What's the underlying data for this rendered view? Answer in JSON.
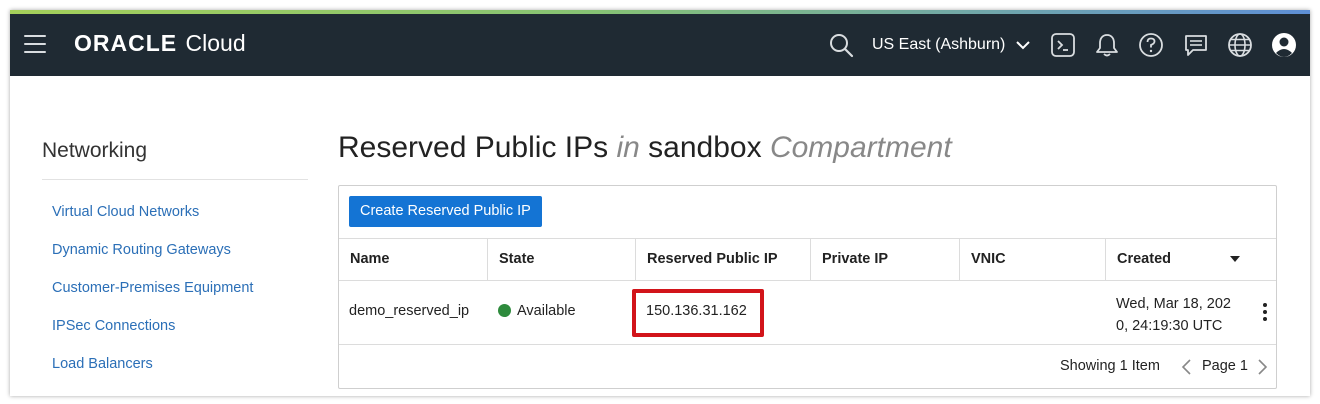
{
  "topbar": {
    "brand_oracle": "ORACLE",
    "brand_cloud": "Cloud",
    "region": "US East (Ashburn)",
    "icons": [
      "menu-icon",
      "search-icon",
      "chevron-down-icon",
      "terminal-icon",
      "bell-icon",
      "help-icon",
      "chat-icon",
      "globe-icon",
      "user-icon"
    ]
  },
  "sidebar": {
    "title": "Networking",
    "items": [
      {
        "label": "Virtual Cloud Networks"
      },
      {
        "label": "Dynamic Routing Gateways"
      },
      {
        "label": "Customer-Premises Equipment"
      },
      {
        "label": "IPSec Connections"
      },
      {
        "label": "Load Balancers"
      }
    ]
  },
  "main": {
    "title_main": "Reserved Public IPs",
    "title_in": "in",
    "title_compartment_name": "sandbox",
    "title_compartment_word": "Compartment",
    "create_button": "Create Reserved Public IP",
    "columns": [
      "Name",
      "State",
      "Reserved Public IP",
      "Private IP",
      "VNIC",
      "Created"
    ],
    "rows": [
      {
        "name": "demo_reserved_ip",
        "state": "Available",
        "reserved_public_ip": "150.136.31.162",
        "private_ip": "",
        "vnic": "",
        "created": "Wed, Mar 18, 2020, 24:19:30 UTC"
      }
    ],
    "footer": {
      "showing": "Showing 1 Item",
      "page": "Page 1"
    }
  },
  "colors": {
    "topbar_bg": "#1f2a33",
    "link": "#2b6fb7",
    "primary_button": "#1474d4",
    "status_available": "#2e8b3d",
    "highlight": "#d2141a"
  }
}
